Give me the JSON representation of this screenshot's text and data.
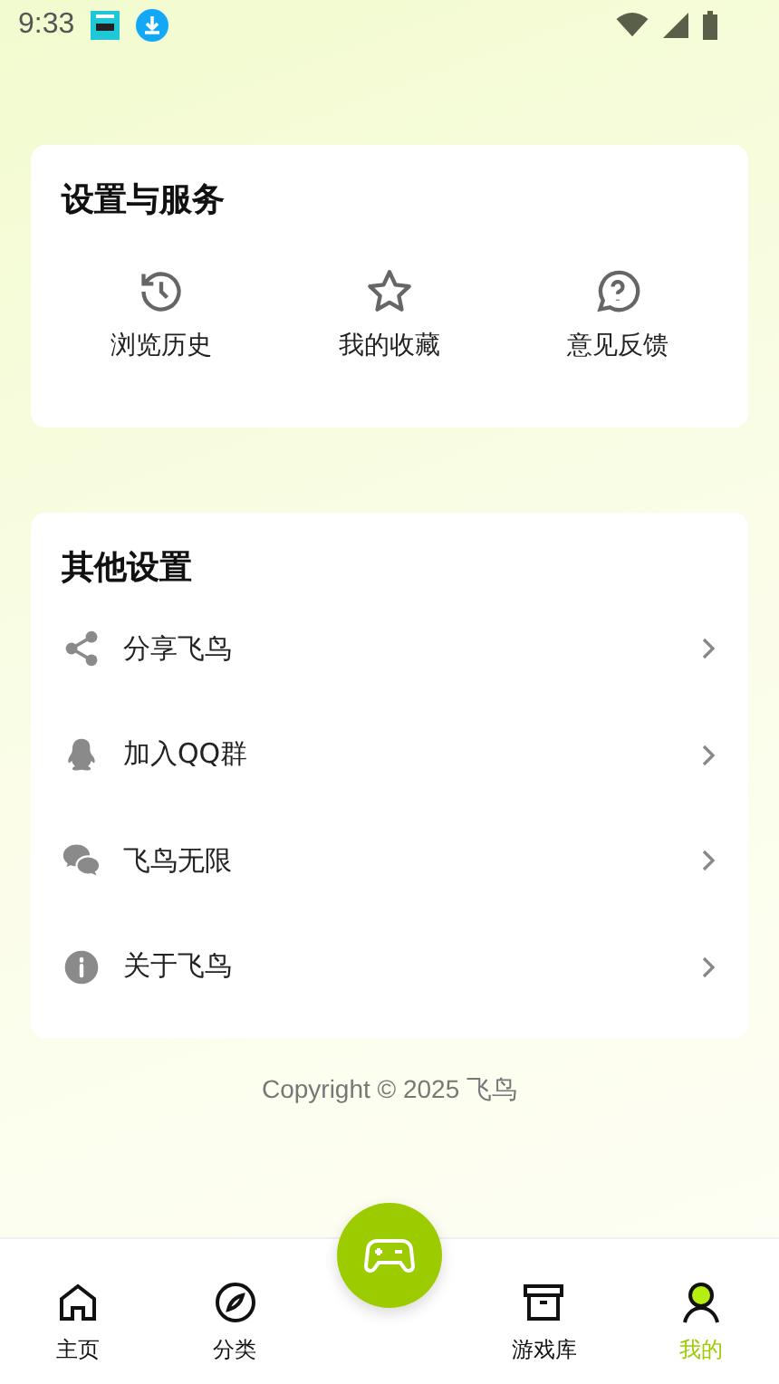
{
  "status_bar": {
    "time": "9:33"
  },
  "services": {
    "title": "设置与服务",
    "items": [
      {
        "kind": "history",
        "label": "浏览历史"
      },
      {
        "kind": "star",
        "label": "我的收藏"
      },
      {
        "kind": "feedback",
        "label": "意见反馈"
      }
    ]
  },
  "other": {
    "title": "其他设置",
    "items": [
      {
        "kind": "share",
        "label": "分享飞鸟"
      },
      {
        "kind": "qq",
        "label": "加入QQ群"
      },
      {
        "kind": "wechat",
        "label": "飞鸟无限"
      },
      {
        "kind": "info",
        "label": "关于飞鸟"
      }
    ]
  },
  "copyright": "Copyright © 2025 飞鸟",
  "tab_bar": [
    {
      "kind": "home",
      "label": "主页",
      "selected": false
    },
    {
      "kind": "compass",
      "label": "分类",
      "selected": false
    },
    {
      "kind": "game",
      "selected": false
    },
    {
      "kind": "box",
      "label": "游戏库",
      "selected": false
    },
    {
      "kind": "user",
      "label": "我的",
      "selected": true
    }
  ]
}
